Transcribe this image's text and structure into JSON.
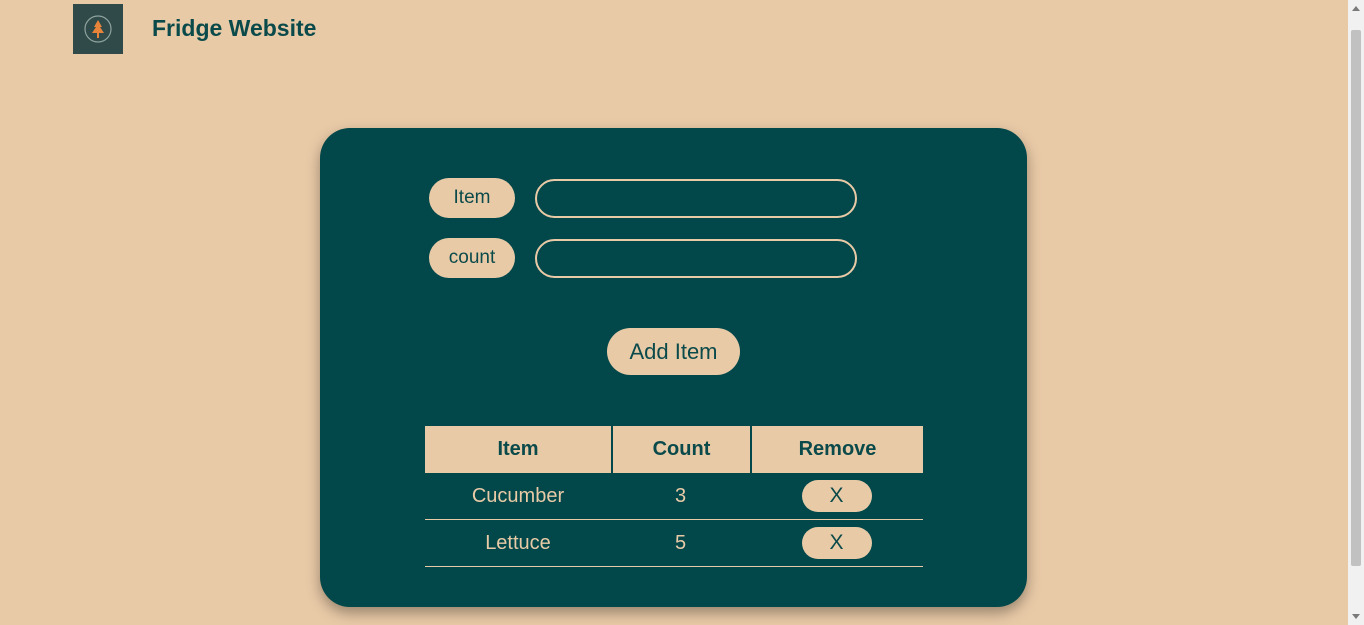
{
  "header": {
    "title": "Fridge Website",
    "logo_icon": "tree-icon"
  },
  "form": {
    "item_label": "Item",
    "item_value": "",
    "count_label": "count",
    "count_value": "",
    "add_button_label": "Add Item"
  },
  "table": {
    "headers": [
      "Item",
      "Count",
      "Remove"
    ],
    "rows": [
      {
        "item": "Cucumber",
        "count": "3",
        "remove_label": "X"
      },
      {
        "item": "Lettuce",
        "count": "5",
        "remove_label": "X"
      }
    ]
  },
  "colors": {
    "background": "#e9caa7",
    "card": "#02484a",
    "accent_text": "#0b4a4a",
    "logo_bg": "#2f4a48",
    "logo_tree": "#e8843a"
  }
}
